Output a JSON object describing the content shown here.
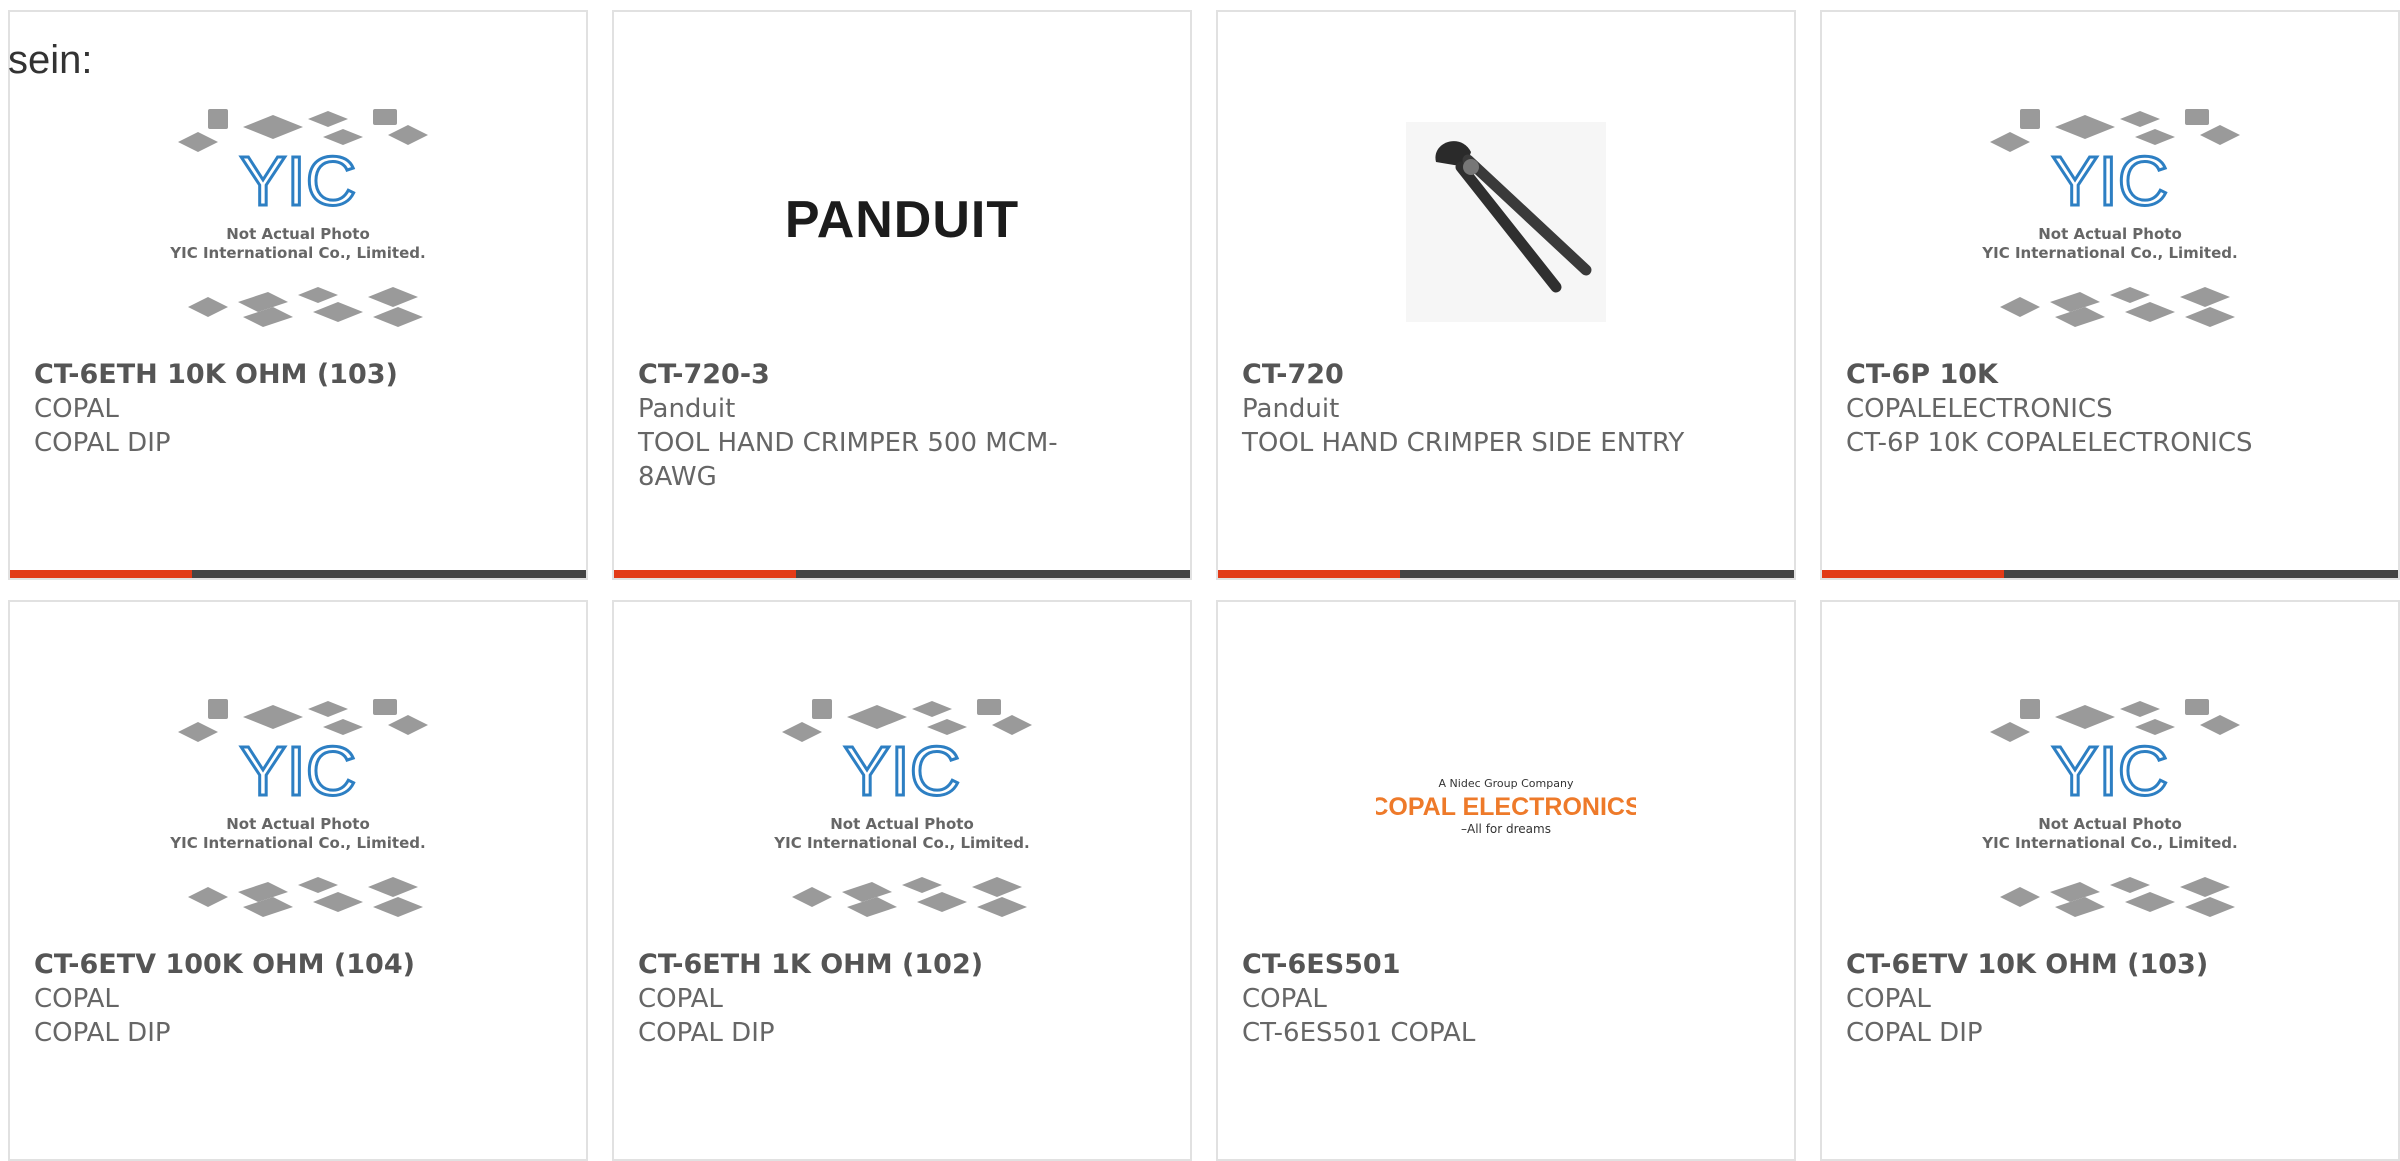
{
  "heading": "sein:",
  "colors": {
    "accent": "#e23a17",
    "bar": "#444444",
    "yic_blue": "#2d7fc3"
  },
  "placeholder": {
    "line1": "Not Actual Photo",
    "line2": "YIC International Co., Limited.",
    "logo": "YIC"
  },
  "logos": {
    "panduit": "PANDUIT",
    "copal_top": "A Nidec Group Company",
    "copal_main": "COPAL ELECTRONICS",
    "copal_tag": "–All for dreams"
  },
  "products": [
    {
      "part": "CT-6ETH 10K OHM (103)",
      "maker": "COPAL",
      "desc": "COPAL DIP",
      "image": "placeholder"
    },
    {
      "part": "CT-720-3",
      "maker": "Panduit",
      "desc": "TOOL HAND CRIMPER 500 MCM-8AWG",
      "image": "panduit-logo"
    },
    {
      "part": "CT-720",
      "maker": "Panduit",
      "desc": "TOOL HAND CRIMPER SIDE ENTRY",
      "image": "crimper-photo"
    },
    {
      "part": "CT-6P 10K",
      "maker": "COPALELECTRONICS",
      "desc": "CT-6P 10K COPALELECTRONICS",
      "image": "placeholder"
    },
    {
      "part": "CT-6ETV 100K OHM (104)",
      "maker": "COPAL",
      "desc": "COPAL DIP",
      "image": "placeholder"
    },
    {
      "part": "CT-6ETH 1K OHM (102)",
      "maker": "COPAL",
      "desc": "COPAL DIP",
      "image": "placeholder"
    },
    {
      "part": "CT-6ES501",
      "maker": "COPAL",
      "desc": "CT-6ES501 COPAL",
      "image": "copal-logo"
    },
    {
      "part": "CT-6ETV 10K OHM (103)",
      "maker": "COPAL",
      "desc": "COPAL DIP",
      "image": "placeholder"
    }
  ]
}
